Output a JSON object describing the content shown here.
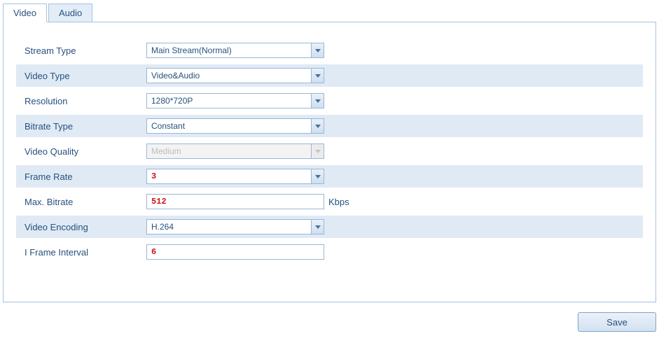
{
  "tabs": {
    "video": "Video",
    "audio": "Audio"
  },
  "fields": {
    "stream_type": {
      "label": "Stream Type",
      "value": "Main Stream(Normal)"
    },
    "video_type": {
      "label": "Video Type",
      "value": "Video&Audio"
    },
    "resolution": {
      "label": "Resolution",
      "value": "1280*720P"
    },
    "bitrate_type": {
      "label": "Bitrate Type",
      "value": "Constant"
    },
    "video_quality": {
      "label": "Video Quality",
      "value": "Medium"
    },
    "frame_rate": {
      "label": "Frame Rate",
      "value": "3"
    },
    "max_bitrate": {
      "label": "Max. Bitrate",
      "value": "512",
      "unit": "Kbps"
    },
    "video_encoding": {
      "label": "Video Encoding",
      "value": "H.264"
    },
    "iframe_interval": {
      "label": "I Frame Interval",
      "value": "6"
    }
  },
  "buttons": {
    "save": "Save"
  }
}
